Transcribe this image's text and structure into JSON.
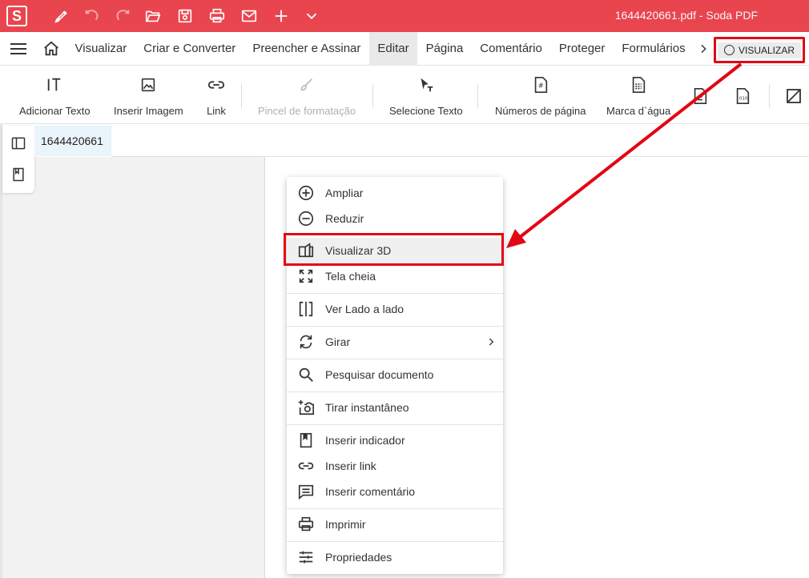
{
  "titlebar": {
    "logo": "S",
    "title": "1644420661.pdf  -  Soda PDF",
    "icons": [
      "pen-icon",
      "undo-icon",
      "redo-icon",
      "open-folder-icon",
      "save-icon",
      "print-icon",
      "mail-icon",
      "plus-icon",
      "chevron-down-icon"
    ],
    "color": "#e8454f"
  },
  "menubar": {
    "tabs": [
      "Visualizar",
      "Criar e Converter",
      "Preencher e Assinar",
      "Editar",
      "Página",
      "Comentário",
      "Proteger",
      "Formulários"
    ],
    "active_tab": "Editar",
    "view_button": "VISUALIZAR"
  },
  "toolbar": {
    "tools": [
      {
        "label": "Adicionar Texto",
        "icon": "add-text-icon"
      },
      {
        "label": "Inserir Imagem",
        "icon": "image-icon"
      },
      {
        "label": "Link",
        "icon": "link-icon"
      },
      {
        "label": "Pincel de formatação",
        "icon": "brush-icon",
        "disabled": true
      },
      {
        "label": "Selecione Texto",
        "icon": "select-text-icon"
      },
      {
        "label": "Números de página",
        "icon": "page-number-icon"
      },
      {
        "label": "Marca d`água",
        "icon": "watermark-icon"
      }
    ]
  },
  "document": {
    "tab_name": "1644420661"
  },
  "context_menu": {
    "items": [
      {
        "label": "Ampliar",
        "icon": "zoom-in-icon"
      },
      {
        "label": "Reduzir",
        "icon": "zoom-out-icon"
      },
      {
        "label": "Visualizar 3D",
        "icon": "view-3d-icon",
        "highlighted": true
      },
      {
        "label": "Tela cheia",
        "icon": "fullscreen-icon"
      },
      {
        "label": "Ver Lado a lado",
        "icon": "side-by-side-icon"
      },
      {
        "label": "Girar",
        "icon": "rotate-icon",
        "submenu": true
      },
      {
        "label": "Pesquisar documento",
        "icon": "search-icon"
      },
      {
        "label": "Tirar instantâneo",
        "icon": "snapshot-icon"
      },
      {
        "label": "Inserir indicador",
        "icon": "bookmark-icon"
      },
      {
        "label": "Inserir link",
        "icon": "link-icon"
      },
      {
        "label": "Inserir comentário",
        "icon": "comment-icon"
      },
      {
        "label": "Imprimir",
        "icon": "print-icon"
      },
      {
        "label": "Propriedades",
        "icon": "properties-icon"
      }
    ]
  },
  "annotation_color": "#e30613"
}
